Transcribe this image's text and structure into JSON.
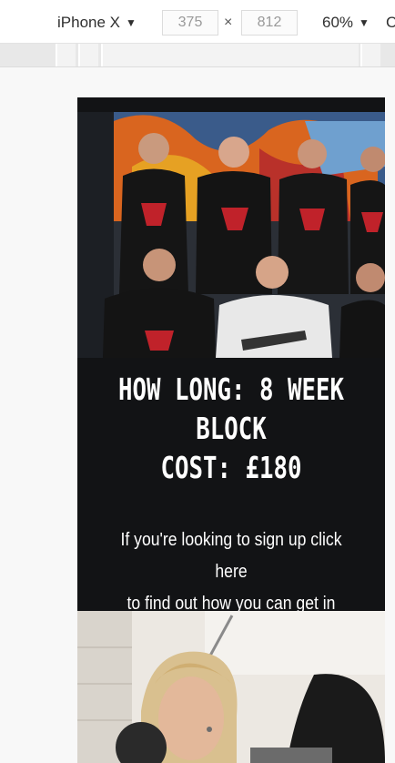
{
  "toolbar": {
    "device": "iPhone X",
    "width_value": "375",
    "height_value": "812",
    "times": "×",
    "zoom": "60%",
    "more": "C"
  },
  "page": {
    "headline_lines": [
      "HOW LONG: 8 WEEK",
      "BLOCK",
      "COST: £180"
    ],
    "cta_lines": [
      "If you're looking to sign up click here",
      "to find out how you can get in touch."
    ]
  },
  "colors": {
    "page_background": "#121315",
    "shirt_red": "#c0222a"
  },
  "icons": {
    "dropdown": "caret-down-icon"
  }
}
